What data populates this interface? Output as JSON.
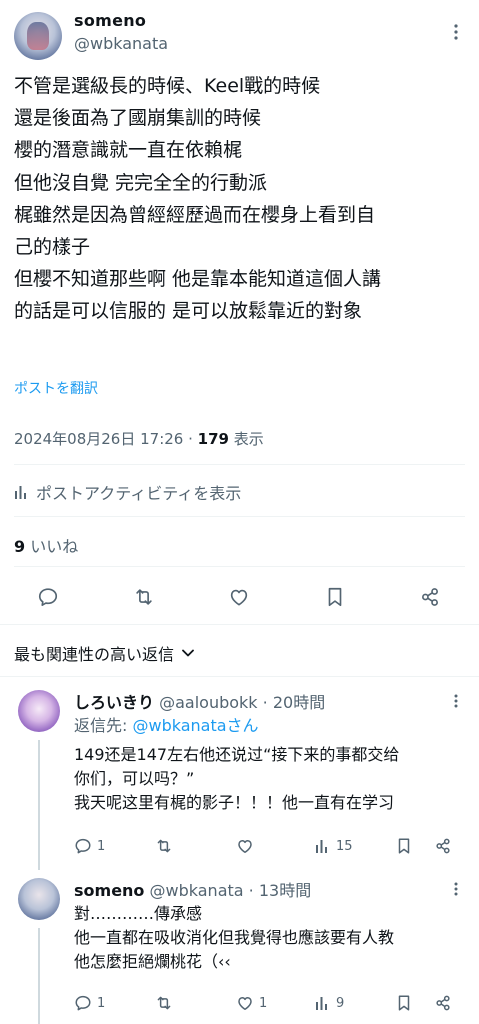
{
  "post": {
    "display_name": "someno",
    "handle": "@wbkanata",
    "lines": [
      "不管是選級長的時候、Keel戰的時候",
      "還是後面為了國崩集訓的時候",
      "櫻的潛意識就一直在依賴梶",
      "但他沒自覺 完完全全的行動派",
      "梶雖然是因為曾經經歷過而在櫻身上看到自",
      "己的樣子",
      "但櫻不知道那些啊 他是靠本能知道這個人講",
      "的話是可以信服的 是可以放鬆靠近的對象"
    ],
    "translate_link": "ポストを翻訳",
    "timestamp": "2024年08月26日 17:26",
    "separator": " · ",
    "views_count": "179",
    "views_label": " 表示",
    "activity_label": "ポストアクティビティを表示",
    "likes_count": "9",
    "likes_label": " いいね"
  },
  "icons": [
    "avatar",
    "more-icon",
    "reply-icon",
    "repost-icon",
    "like-icon",
    "bookmark-icon",
    "share-icon",
    "analytics-icon",
    "chevron-down-icon"
  ],
  "sort": {
    "label": "最も関連性の高い返信"
  },
  "replies": [
    {
      "display_name": "しろいきり",
      "handle": "@aaloubokk",
      "time": " · 20時間",
      "replying_prefix": "返信先: ",
      "replying_handle": "@wbkanataさん",
      "lines": [
        "149还是147左右他还说过“接下来的事都交给",
        "你们，可以吗？”",
        "我天呢这里有梶的影子！！！他一直有在学习"
      ],
      "reply_count": "1",
      "repost_count": "",
      "like_count": "",
      "view_count": "15"
    },
    {
      "display_name": "someno",
      "handle": "@wbkanata",
      "time": " · 13時間",
      "lines": [
        "對…………傳承感",
        "他一直都在吸收消化但我覺得也應該要有人教",
        "他怎麼拒絕爛桃花（‹‹"
      ],
      "reply_count": "1",
      "repost_count": "",
      "like_count": "1",
      "view_count": "9"
    }
  ],
  "colors": {
    "text": "#0f1419",
    "secondary": "#536471",
    "link": "#1d9bf0",
    "divider": "#eff3f4"
  }
}
